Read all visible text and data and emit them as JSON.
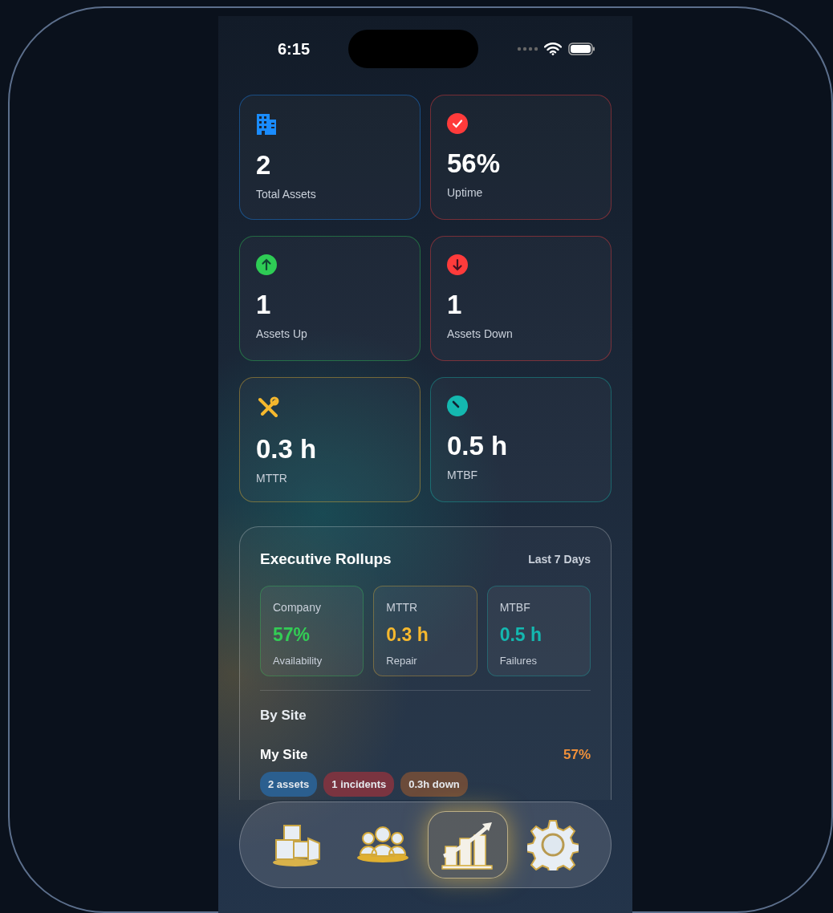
{
  "status_bar": {
    "time": "6:15"
  },
  "stats": [
    {
      "kind": "building",
      "value": "2",
      "label": "Total Assets",
      "color": "#1a8cff"
    },
    {
      "kind": "check",
      "value": "56%",
      "label": "Uptime",
      "color": "#ff3b3b"
    },
    {
      "kind": "up",
      "value": "1",
      "label": "Assets Up",
      "color": "#2ecc55"
    },
    {
      "kind": "down",
      "value": "1",
      "label": "Assets Down",
      "color": "#ff3b3b"
    },
    {
      "kind": "tools",
      "value": "0.3 h",
      "label": "MTTR",
      "color": "#f5b82e"
    },
    {
      "kind": "gauge",
      "value": "0.5 h",
      "label": "MTBF",
      "color": "#14b8b0"
    }
  ],
  "rollups": {
    "title": "Executive Rollups",
    "period": "Last 7 Days",
    "metrics": [
      {
        "title": "Company",
        "value": "57%",
        "caption": "Availability",
        "color": "#33cc55"
      },
      {
        "title": "MTTR",
        "value": "0.3 h",
        "caption": "Repair",
        "color": "#f5b82e"
      },
      {
        "title": "MTBF",
        "value": "0.5 h",
        "caption": "Failures",
        "color": "#14b8b0"
      }
    ],
    "by_site_heading": "By Site",
    "sites": [
      {
        "name": "My Site",
        "availability": "57%",
        "tags": [
          {
            "text": "2 assets",
            "color": "#2b5f8f"
          },
          {
            "text": "1 incidents",
            "color": "#7a3440"
          },
          {
            "text": "0.3h down",
            "color": "#6b4b3a"
          }
        ]
      }
    ]
  },
  "tab_bar": [
    {
      "kind": "inventory",
      "selected": false
    },
    {
      "kind": "team",
      "selected": false
    },
    {
      "kind": "reports",
      "selected": true
    },
    {
      "kind": "settings",
      "selected": false
    }
  ]
}
